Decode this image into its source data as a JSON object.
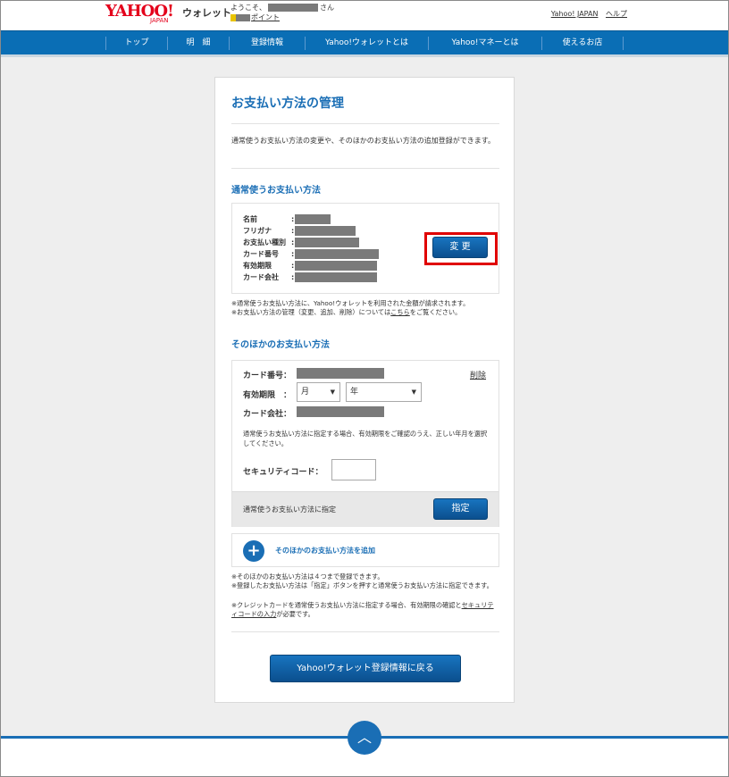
{
  "header": {
    "logo_text": "YAHOO!",
    "logo_sub": "JAPAN",
    "service_name": "ウォレット",
    "welcome_prefix": "ようこそ、",
    "welcome_suffix": "さん",
    "points_label": "ポイント",
    "links": [
      "Yahoo! JAPAN",
      "ヘルプ"
    ]
  },
  "nav": {
    "items": [
      "トップ",
      "明　細",
      "登録情報",
      "Yahoo!ウォレットとは",
      "Yahoo!マネーとは",
      "使えるお店"
    ]
  },
  "page": {
    "title": "お支払い方法の管理",
    "lead": "通常使うお支払い方法の変更や、そのほかのお支払い方法の追加登録ができます。"
  },
  "default_method": {
    "heading": "通常使うお支払い方法",
    "fields": [
      {
        "label": "名前"
      },
      {
        "label": "フリガナ"
      },
      {
        "label": "お支払い種別"
      },
      {
        "label": "カード番号"
      },
      {
        "label": "有効期限"
      },
      {
        "label": "カード会社"
      }
    ],
    "change_button": "変 更",
    "notes": [
      "※通常使うお支払い方法に、Yahoo!ウォレットを利用された金額が請求されます。",
      "※お支払い方法の管理（変更、追加、削除）については",
      "こちら",
      "をご覧ください。"
    ]
  },
  "other_methods": {
    "heading": "そのほかのお支払い方法",
    "card_number_label": "カード番号：",
    "delete_link": "削除",
    "expiry_label": "有効期限　：",
    "month_placeholder": "月",
    "year_placeholder": "年",
    "company_label": "カード会社：",
    "description": "通常使うお支払い方法に指定する場合、有効期限をご確認のうえ、正しい年月を選択してください。",
    "security_label": "セキュリティコード：",
    "assign_text": "通常使うお支払い方法に指定",
    "assign_button": "指定",
    "add_label": "そのほかのお支払い方法を追加"
  },
  "bottom_notes": {
    "line1": "※そのほかのお支払い方法は４つまで登録できます。",
    "line2": "※登録したお支払い方法は「指定」ボタンを押すと通常使うお支払い方法に指定できます。",
    "line3a": "※クレジットカードを通常使うお支払い方法に指定する場合、有効期限の確認と",
    "line3b": "セキュリティコードの入力",
    "line3c": "が必要です。"
  },
  "back_button": "Yahoo!ウォレット登録情報に戻る",
  "colors": {
    "accent": "#1a6eb5",
    "nav_bg": "#0a6eb5",
    "highlight": "#e00000"
  }
}
